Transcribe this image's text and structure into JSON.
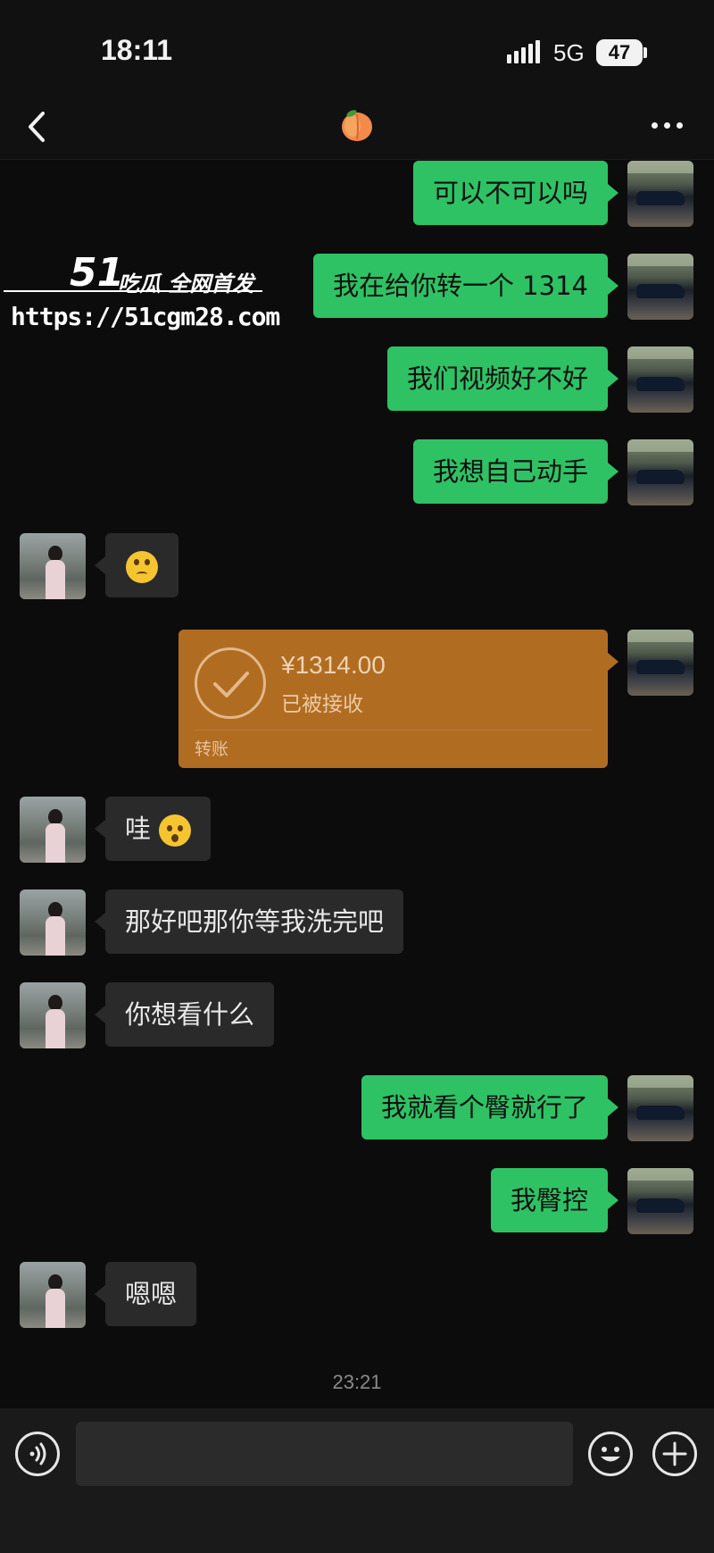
{
  "status_bar": {
    "time": "18:11",
    "network": "5G",
    "battery": "47"
  },
  "header": {
    "title_icon": "peach-emoji"
  },
  "messages": [
    {
      "side": "out",
      "text": "可以不可以吗"
    },
    {
      "side": "out",
      "text": "我在给你转一个 1314"
    },
    {
      "side": "out",
      "text": "我们视频好不好"
    },
    {
      "side": "out",
      "text": "我想自己动手"
    },
    {
      "side": "in",
      "emoji": "rolling-eyes-emoji"
    },
    {
      "side": "out",
      "type": "transfer",
      "amount": "¥1314.00",
      "status": "已被接收",
      "label": "转账"
    },
    {
      "side": "in",
      "text": "哇",
      "emoji": "hushed-face-emoji"
    },
    {
      "side": "in",
      "text": "那好吧那你等我洗完吧"
    },
    {
      "side": "in",
      "text": "你想看什么"
    },
    {
      "side": "out",
      "text": "我就看个臀就行了"
    },
    {
      "side": "out",
      "text": "我臀控"
    },
    {
      "side": "in",
      "text": "嗯嗯"
    }
  ],
  "timestamp": "23:21",
  "input_bar": {
    "voice_icon": "voice-icon",
    "emoji_icon": "emoji-icon",
    "plus_icon": "plus-icon",
    "placeholder": ""
  },
  "watermark": {
    "brand": "51",
    "tagline": "吃瓜 全网首发",
    "url": "https://51cgm28.com"
  }
}
